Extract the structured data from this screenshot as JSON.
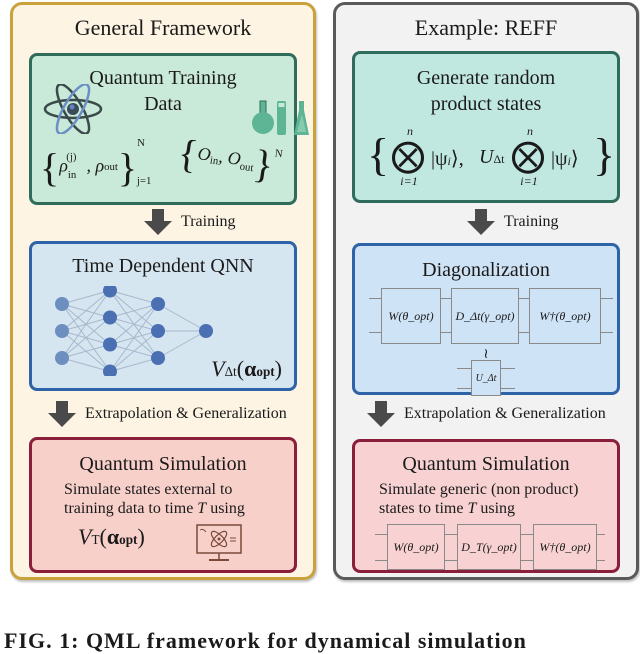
{
  "left": {
    "title": "General Framework",
    "data_box": {
      "title_line1": "Quantum Training",
      "title_line2": "Data",
      "icons": [
        "atom-icon",
        "lab-glassware-icon"
      ],
      "formula_rho": "{ρ_in^(j), ρ_out^(j)}_{j=1}^N",
      "formula_O": "{O_in^(j), O_out^(j)}_{j=1}^N",
      "rho_in": "ρ",
      "rho_out": "ρ",
      "sup_j": "(j)",
      "sub_in": "in",
      "sub_out": "out",
      "N": "N",
      "j1": "j=1",
      "O": "O"
    },
    "arrow1_label": "Training",
    "qnn_box": {
      "title": "Time Dependent QNN",
      "network_layers": [
        3,
        4,
        3,
        1
      ],
      "operator": "V",
      "operator_sub": "Δt",
      "operator_arg": "α",
      "operator_arg_sub": "opt"
    },
    "arrow2_label": "Extrapolation & Generalization",
    "sim_box": {
      "title": "Quantum Simulation",
      "desc_line1": "Simulate states external to",
      "desc_line2_pre": "training data to time ",
      "desc_T": "T",
      "desc_line2_post": " using",
      "operator": "V",
      "operator_sub": "T",
      "operator_arg": "α",
      "operator_arg_sub": "opt",
      "icon": "quantum-computer-monitor-icon"
    }
  },
  "right": {
    "title": "Example: REFF",
    "data_box": {
      "title_line1": "Generate random",
      "title_line2": "product states",
      "formula": "{⊗_{i=1}^n |ψ_i⟩, U_Δt ⊗_{i=1}^n |ψ_i⟩}",
      "otimes": "⨂",
      "n": "n",
      "i1": "i=1",
      "ket": "|ψ",
      "ket_sub": "i",
      "ket_close": "⟩",
      "U": "U",
      "U_sub": "Δt"
    },
    "arrow1_label": "Training",
    "diag_box": {
      "title": "Diagonalization",
      "gates": [
        "W(θ_opt)",
        "D_Δt(γ_opt)",
        "W†(θ_opt)"
      ],
      "approx": "≀",
      "target_gate": "U_Δt"
    },
    "arrow2_label": "Extrapolation & Generalization",
    "sim_box": {
      "title": "Quantum Simulation",
      "desc_line1": "Simulate generic (non product)",
      "desc_line2_pre": "states to time ",
      "desc_T": "T",
      "desc_line2_post": " using",
      "gates": [
        "W(θ_opt)",
        "D_T(γ_opt)",
        "W†(θ_opt)"
      ]
    }
  },
  "caption": "FIG. 1: QML framework for dynamical simulation"
}
